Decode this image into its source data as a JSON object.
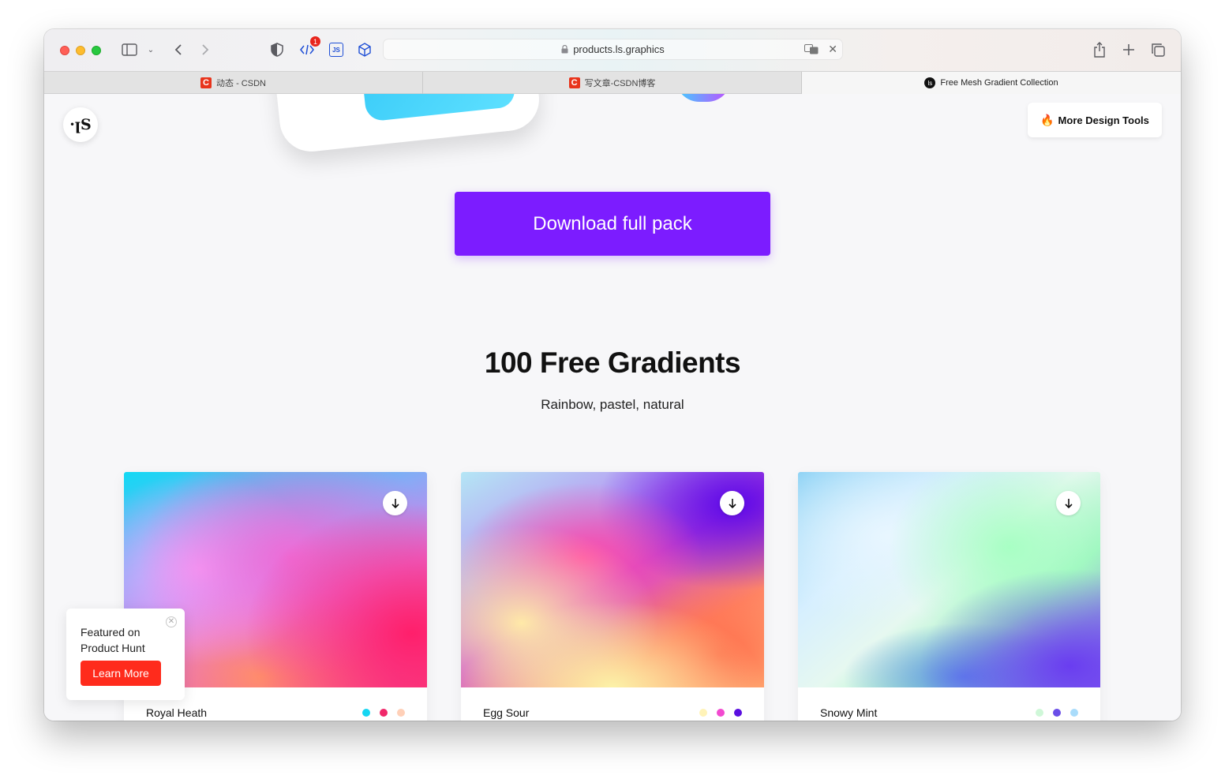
{
  "browser": {
    "url": "products.ls.graphics",
    "extension_badge": "1",
    "extension_js_label": "JS",
    "tabs": [
      {
        "title": "动态 - CSDN",
        "favicon": "C"
      },
      {
        "title": "写文章-CSDN博客",
        "favicon": "C"
      },
      {
        "title": "Free Mesh Gradient Collection",
        "favicon": "ls"
      }
    ]
  },
  "header": {
    "logo_text": "·ꞁS",
    "more_tools_label": "More Design Tools",
    "more_tools_icon": "🔥"
  },
  "hero": {
    "download_label": "Download full pack"
  },
  "section": {
    "title": "100 Free Gradients",
    "subtitle": "Rainbow, pastel, natural"
  },
  "cards": [
    {
      "name": "Royal Heath",
      "colors": [
        "#16d6f2",
        "#f0286a",
        "#ffd0b8"
      ]
    },
    {
      "name": "Egg Sour",
      "colors": [
        "#fff3b8",
        "#f24ad0",
        "#5a0fe0"
      ]
    },
    {
      "name": "Snowy Mint",
      "colors": [
        "#cff7d8",
        "#6a4ee8",
        "#a9dcfb"
      ]
    }
  ],
  "product_hunt": {
    "line1": "Featured on",
    "line2": "Product Hunt",
    "button_label": "Learn More"
  },
  "colors": {
    "accent": "#7c1cff",
    "product_hunt": "#ff2b1c"
  }
}
